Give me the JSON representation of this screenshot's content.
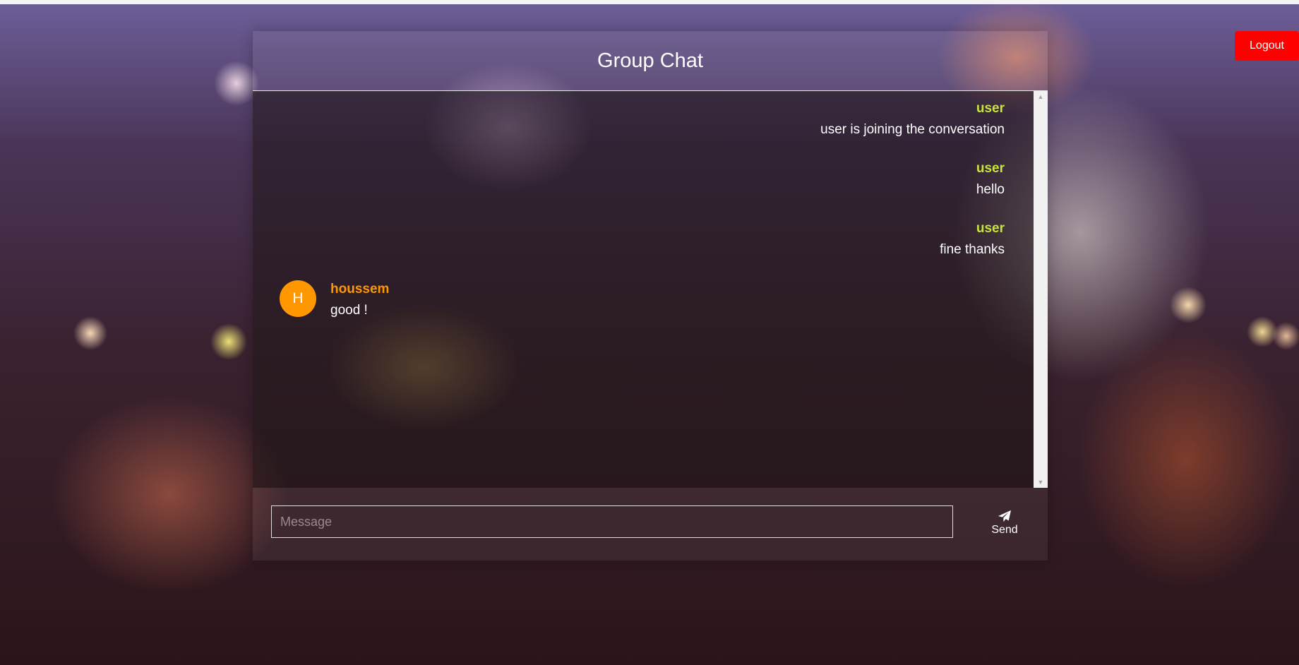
{
  "header": {
    "logout_label": "Logout"
  },
  "chat": {
    "title": "Group Chat",
    "messages": [
      {
        "sender": "user",
        "text": "user is joining the conversation",
        "align": "right"
      },
      {
        "sender": "user",
        "text": "hello",
        "align": "right"
      },
      {
        "sender": "user",
        "text": "fine thanks",
        "align": "right"
      },
      {
        "sender": "houssem",
        "text": "good !",
        "align": "left",
        "avatar_initial": "H"
      }
    ]
  },
  "composer": {
    "placeholder": "Message",
    "value": "",
    "send_label": "Send",
    "send_icon": "paper-plane-icon"
  },
  "colors": {
    "logout": "#ff0000",
    "own_sender": "#c8e33f",
    "other_sender": "#ff9800",
    "avatar": "#ff9800"
  }
}
